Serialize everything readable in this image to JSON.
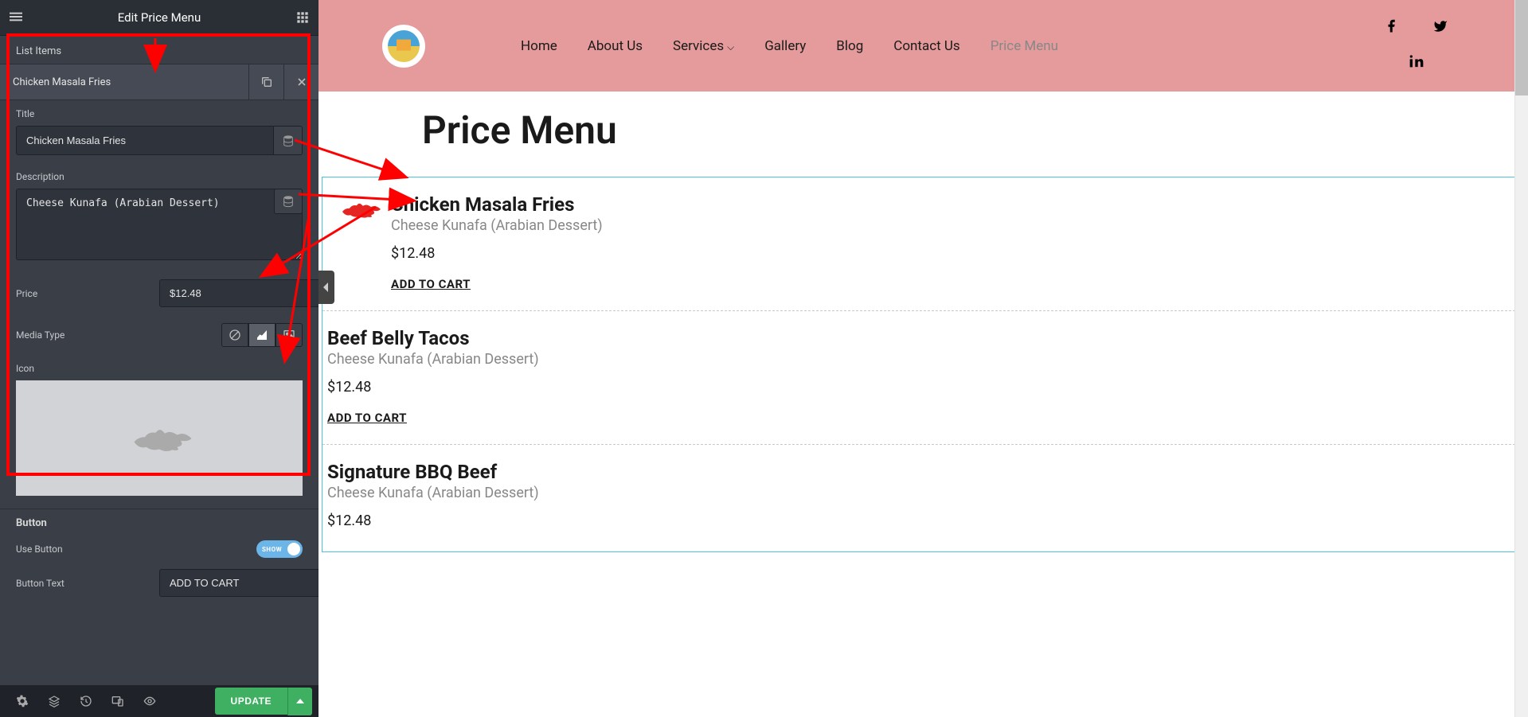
{
  "sidebar": {
    "title": "Edit Price Menu",
    "list_items_label": "List Items",
    "item_name": "Chicken Masala Fries",
    "fields": {
      "title_label": "Title",
      "title_value": "Chicken Masala Fries",
      "description_label": "Description",
      "description_value": "Cheese Kunafa (Arabian Dessert)",
      "price_label": "Price",
      "price_value": "$12.48",
      "media_type_label": "Media Type",
      "icon_label": "Icon"
    },
    "button_section": {
      "heading": "Button",
      "use_button_label": "Use Button",
      "use_button_value": true,
      "toggle_text": "SHOW",
      "button_text_label": "Button Text",
      "button_text_value": "ADD TO CART"
    },
    "footer": {
      "update": "UPDATE"
    }
  },
  "preview": {
    "nav": {
      "items": [
        "Home",
        "About Us",
        "Services",
        "Gallery",
        "Blog",
        "Contact Us",
        "Price Menu"
      ]
    },
    "page_title": "Price Menu",
    "menu": [
      {
        "title": "Chicken Masala Fries",
        "desc": "Cheese Kunafa (Arabian Dessert)",
        "price": "$12.48",
        "button": "ADD TO CART",
        "has_icon": true
      },
      {
        "title": "Beef Belly Tacos",
        "desc": "Cheese Kunafa (Arabian Dessert)",
        "price": "$12.48",
        "button": "ADD TO CART",
        "has_icon": false
      },
      {
        "title": "Signature BBQ Beef",
        "desc": "Cheese Kunafa (Arabian Dessert)",
        "price": "$12.48",
        "button": "",
        "has_icon": false
      }
    ]
  }
}
